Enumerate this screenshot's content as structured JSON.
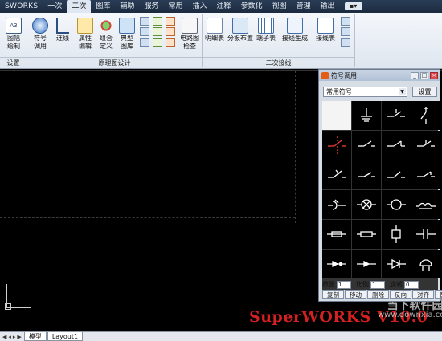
{
  "menubar": {
    "title": "SWORKS",
    "tabs": [
      "一次",
      "二次",
      "图库",
      "辅助",
      "服务",
      "常用",
      "插入",
      "注释",
      "参数化",
      "视图",
      "管理",
      "输出"
    ],
    "active_tab": "二次"
  },
  "ribbon": {
    "buttons": [
      {
        "label": "图幅\n绘制",
        "icon": "sheet-icon"
      },
      {
        "label": "符号\n调用",
        "icon": "symbol-call-icon"
      },
      {
        "label": "连线",
        "icon": "wire-icon"
      },
      {
        "label": "属性\n编辑",
        "icon": "attribute-icon"
      },
      {
        "label": "组合\n定义",
        "icon": "group-icon"
      },
      {
        "label": "典型\n图库",
        "icon": "library-icon"
      },
      {
        "label": "电路图\n检查",
        "icon": "check-icon"
      },
      {
        "label": "明细表",
        "icon": "table-icon"
      },
      {
        "label": "分板布置",
        "icon": "layout-icon"
      },
      {
        "label": "端子表",
        "icon": "terminal-icon"
      },
      {
        "label": "接线生成",
        "icon": "wiring-icon"
      },
      {
        "label": "接线表",
        "icon": "wiring-table-icon"
      }
    ],
    "groups": [
      "设置",
      "原理图设计",
      "二次接线"
    ]
  },
  "panel": {
    "title": "符号调用",
    "combo_value": "常用符号",
    "settings_label": "设置",
    "qty_label": "数量",
    "qty_value": "1",
    "scale_label": "比例",
    "scale_value": "1",
    "rotate_label": "旋转",
    "rotate_value": "0",
    "buttons": [
      "复制",
      "移动",
      "删除",
      "反向",
      "对齐",
      "替换"
    ]
  },
  "bottom": {
    "tabs": [
      "模型",
      "Layout1"
    ]
  },
  "watermark": {
    "text": "SuperWORKS V10.0",
    "site_cn": "当下软件园",
    "site_url": "www.downxia.com"
  }
}
